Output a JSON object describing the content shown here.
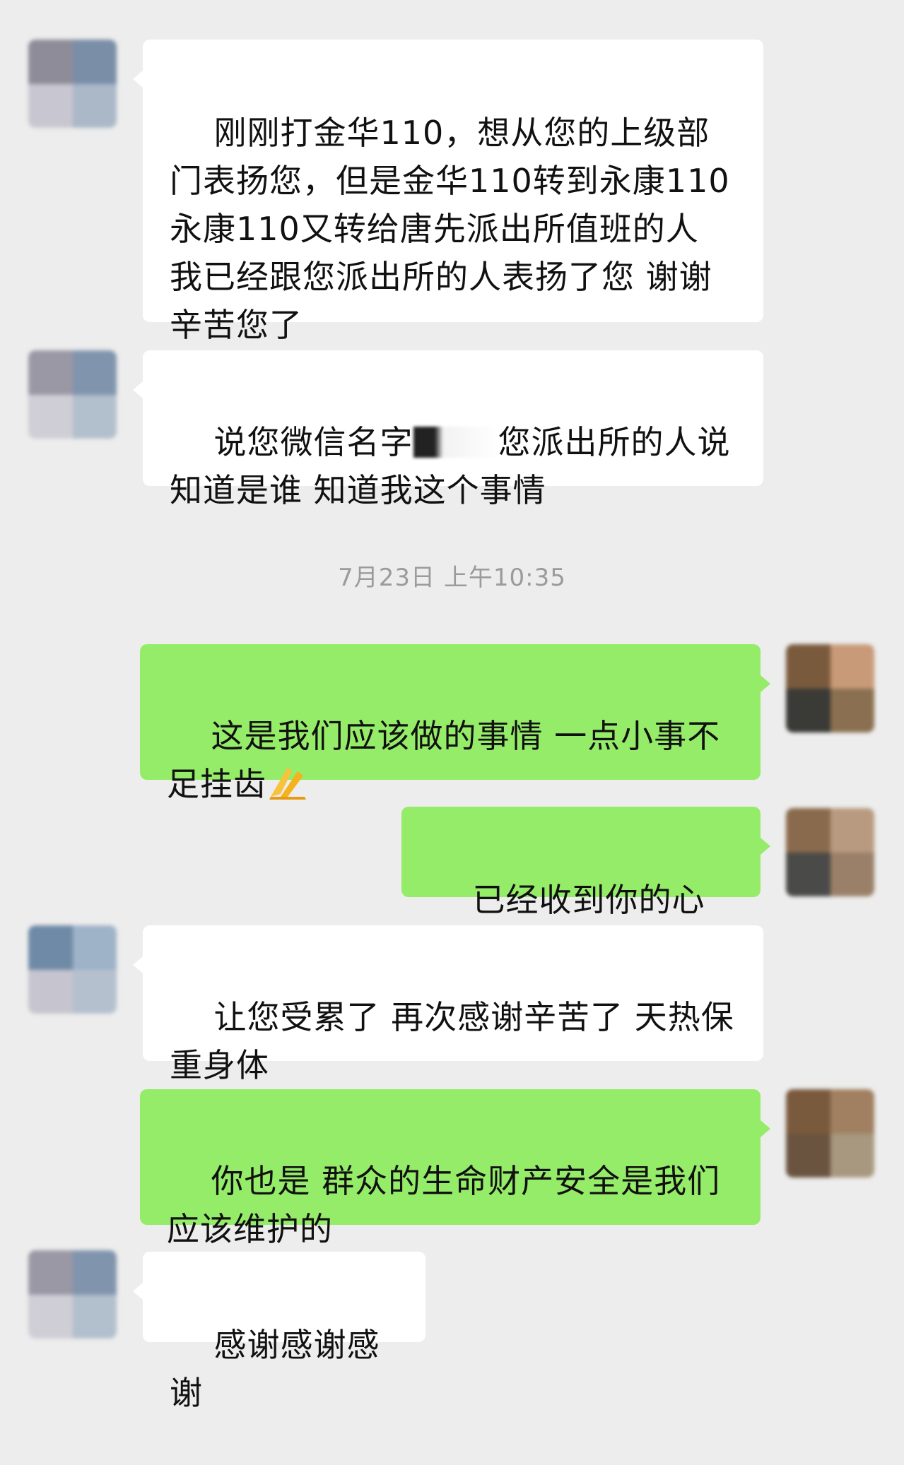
{
  "timestamp": "7月23日 上午10:35",
  "messages": [
    {
      "side": "in",
      "text": "刚刚打金华110，想从您的上级部门表扬您，但是金华110转到永康110 永康110又转给唐先派出所值班的人 我已经跟您派出所的人表扬了您 谢谢辛苦您了"
    },
    {
      "side": "in",
      "text_before": "说您微信名字",
      "text_after": "您派出所的人说知道是谁 知道我这个事情",
      "redacted": true
    },
    {
      "side": "out",
      "text": "这是我们应该做的事情 一点小事不足挂齿",
      "emoji": "folded-hands-emoji"
    },
    {
      "side": "out",
      "text": "已经收到你的心意"
    },
    {
      "side": "in",
      "text": "让您受累了 再次感谢辛苦了 天热保重身体"
    },
    {
      "side": "out",
      "text": "你也是 群众的生命财产安全是我们应该维护的"
    },
    {
      "side": "in",
      "text": "感谢感谢感谢"
    }
  ],
  "avatars": {
    "contact": {
      "colors": [
        "#8e8c99",
        "#7a8ea8",
        "#c8c6d0",
        "#aab8c8"
      ]
    },
    "self": {
      "colors": [
        "#7a5a3c",
        "#c89a78",
        "#3a3a36",
        "#8a7050"
      ]
    }
  },
  "colors": {
    "background": "#ededed",
    "incoming_bubble": "#ffffff",
    "outgoing_bubble": "#95ec69",
    "timestamp_text": "#9b9b9b"
  }
}
